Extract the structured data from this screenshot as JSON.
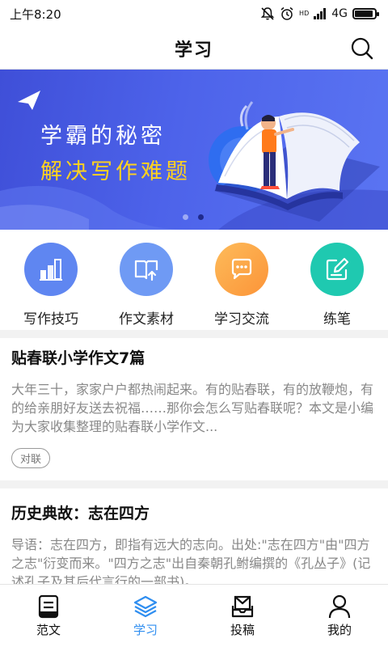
{
  "status_bar": {
    "time": "上午8:20",
    "network": "4G",
    "hd_label": "HD",
    "battery_percent": 90,
    "icons": [
      "mute-icon",
      "alarm-icon",
      "signal-icon",
      "battery-icon"
    ]
  },
  "header": {
    "title": "学习",
    "search_icon": "search-icon"
  },
  "banner": {
    "line1": "学霸的秘密",
    "line2": "解决写作难题",
    "slide_count": 2,
    "active_slide": 2,
    "colors": {
      "background": "#4557e0",
      "highlight": "#ffd21e",
      "book": "#e9edf8"
    }
  },
  "categories": [
    {
      "label": "写作技巧",
      "icon": "chart-building-icon",
      "color": "#5f86f1"
    },
    {
      "label": "作文素材",
      "icon": "book-upload-icon",
      "color": "#6f9af4"
    },
    {
      "label": "学习交流",
      "icon": "chat-bubble-icon",
      "color": "#fca446"
    },
    {
      "label": "练笔",
      "icon": "edit-square-icon",
      "color": "#1fc9b0"
    }
  ],
  "articles": [
    {
      "title": "贴春联小学作文7篇",
      "excerpt": "大年三十，家家户户都热闹起来。有的贴春联，有的放鞭炮，有的给亲朋好友送去祝福……那你会怎么写贴春联呢？本文是小编为大家收集整理的贴春联小学作文...",
      "tag": "对联"
    },
    {
      "title": "历史典故：志在四方",
      "excerpt": "导语：志在四方，即指有远大的志向。出处:\"志在四方\"由\"四方之志\"衍变而来。\"四方之志\"出自秦朝孔鲋编撰的《孔丛子》(记述孔子及其后代言行的一部书)。",
      "tag": ""
    }
  ],
  "bottom_nav": [
    {
      "label": "范文",
      "icon": "document-icon",
      "active": false
    },
    {
      "label": "学习",
      "icon": "layers-icon",
      "active": true
    },
    {
      "label": "投稿",
      "icon": "mail-tray-icon",
      "active": false
    },
    {
      "label": "我的",
      "icon": "user-icon",
      "active": false
    }
  ],
  "colors": {
    "accent": "#2f8ef0",
    "text_primary": "#111111",
    "text_secondary": "#888888"
  }
}
